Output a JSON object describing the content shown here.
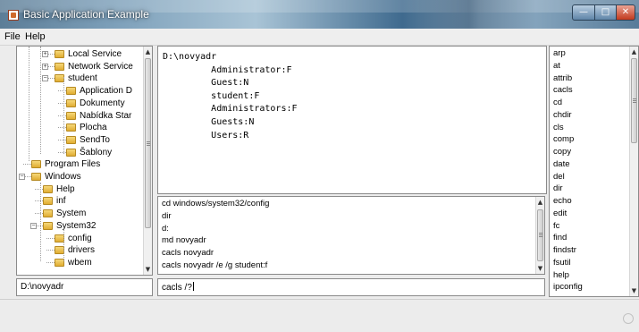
{
  "window": {
    "title": "Basic Application Example",
    "controls": {
      "minimize": "—",
      "maximize": "□",
      "close": "✕"
    }
  },
  "menu": [
    "File",
    "Help"
  ],
  "tree": {
    "nodes": [
      {
        "label": "Local Service",
        "level": 3,
        "expander": "+"
      },
      {
        "label": "Network Service",
        "level": 3,
        "expander": "+"
      },
      {
        "label": "student",
        "level": 3,
        "expander": "−"
      },
      {
        "label": "Application D",
        "level": 4,
        "expander": ""
      },
      {
        "label": "Dokumenty",
        "level": 4,
        "expander": ""
      },
      {
        "label": "Nabídka Star",
        "level": 4,
        "expander": ""
      },
      {
        "label": "Plocha",
        "level": 4,
        "expander": ""
      },
      {
        "label": "SendTo",
        "level": 4,
        "expander": ""
      },
      {
        "label": "Šablony",
        "level": 4,
        "expander": ""
      },
      {
        "label": "Program Files",
        "level": 1,
        "expander": ""
      },
      {
        "label": "Windows",
        "level": 1,
        "expander": "−"
      },
      {
        "label": "Help",
        "level": 2,
        "expander": ""
      },
      {
        "label": "inf",
        "level": 2,
        "expander": ""
      },
      {
        "label": "System",
        "level": 2,
        "expander": ""
      },
      {
        "label": "System32",
        "level": 2,
        "expander": "−"
      },
      {
        "label": "config",
        "level": 3,
        "expander": ""
      },
      {
        "label": "drivers",
        "level": 3,
        "expander": ""
      },
      {
        "label": "wbem",
        "level": 3,
        "expander": ""
      }
    ]
  },
  "current_path": "D:\\novyadr",
  "output": {
    "lines": [
      "D:\\novyadr",
      "         Administrator:F",
      "         Guest:N",
      "         student:F",
      "         Administrators:F",
      "         Guests:N",
      "         Users:R"
    ]
  },
  "history": {
    "lines": [
      "cd windows/system32/config",
      "dir",
      "d:",
      "md novyadr",
      "cacls novyadr",
      "cacls novyadr /e /g student:f"
    ]
  },
  "command_input": "cacls /?",
  "commands": [
    "arp",
    "at",
    "attrib",
    "cacls",
    "cd",
    "chdir",
    "cls",
    "comp",
    "copy",
    "date",
    "del",
    "dir",
    "echo",
    "edit",
    "fc",
    "find",
    "findstr",
    "fsutil",
    "help",
    "ipconfig"
  ]
}
